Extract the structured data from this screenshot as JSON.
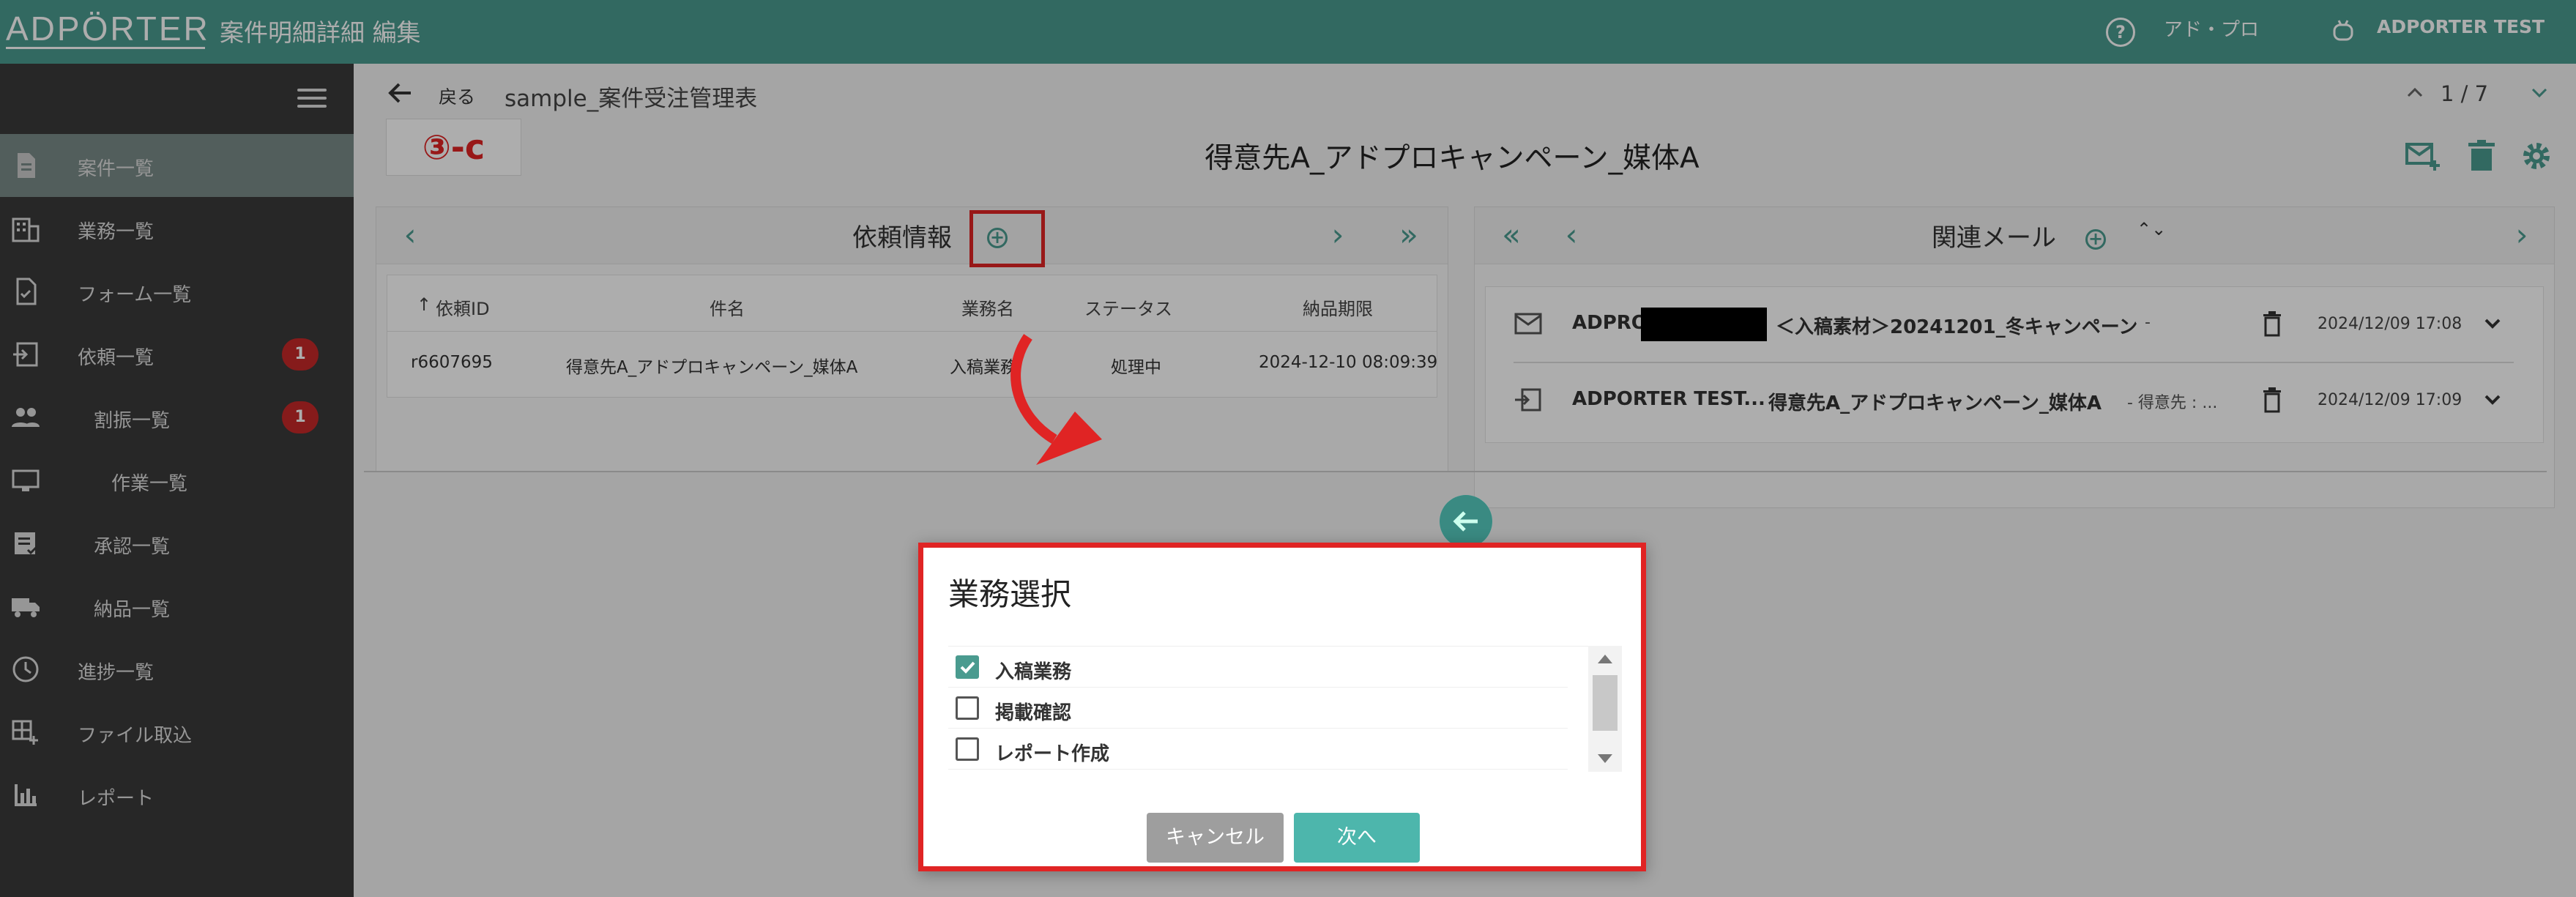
{
  "header": {
    "logo": "ADPÖRTER",
    "app_title": "案件明細詳細 編集",
    "help_glyph": "?",
    "user_org": "アド・プロ",
    "user_name": "ADPORTER TEST"
  },
  "sidebar": {
    "items": [
      {
        "label": "案件一覧",
        "icon": "document-icon",
        "active": true
      },
      {
        "label": "業務一覧",
        "icon": "building-icon"
      },
      {
        "label": "フォーム一覧",
        "icon": "form-icon"
      },
      {
        "label": "依頼一覧",
        "icon": "login-icon",
        "badge": "1"
      },
      {
        "label": "割振一覧",
        "icon": "people-icon",
        "badge": "1"
      },
      {
        "label": "作業一覧",
        "icon": "monitor-icon"
      },
      {
        "label": "承認一覧",
        "icon": "approve-icon"
      },
      {
        "label": "納品一覧",
        "icon": "truck-icon"
      },
      {
        "label": "進捗一覧",
        "icon": "clock-icon"
      },
      {
        "label": "ファイル取込",
        "icon": "table-add-icon"
      },
      {
        "label": "レポート",
        "icon": "bar-chart-icon"
      }
    ]
  },
  "topbar": {
    "back_label": "戻る",
    "sheet_title": "sample_案件受注管理表",
    "pager": "1 / 7"
  },
  "step_label": "③-c",
  "case_title": "得意先A_アドプロキャンペーン_媒体A",
  "request_panel": {
    "title": "依頼情報",
    "columns": [
      "依頼ID",
      "件名",
      "業務名",
      "ステータス",
      "納品期限"
    ],
    "sort_indicator": "↑",
    "rows": [
      [
        "r6607695",
        "得意先A_アドプロキャンペーン_媒体A",
        "入稿業務",
        "処理中",
        "2024-12-10 08:09:39"
      ]
    ]
  },
  "mail_panel": {
    "title": "関連メール",
    "sort_glyph": "⌃⌄",
    "items": [
      {
        "from": "ADPRO",
        "subject": "＜入稿素材＞20241201_冬キャンペーン",
        "extra": "-",
        "date": "2024/12/09 17:08"
      },
      {
        "from": "ADPORTER TEST...",
        "subject": "得意先A_アドプロキャンペーン_媒体A",
        "extra": "- 得意先 : ...",
        "date": "2024/12/09 17:09"
      }
    ]
  },
  "dialog": {
    "title": "業務選択",
    "options": [
      {
        "label": "入稿業務",
        "checked": true
      },
      {
        "label": "掲載確認",
        "checked": false
      },
      {
        "label": "レポート作成",
        "checked": false
      }
    ],
    "cancel_label": "キャンセル",
    "next_label": "次へ"
  },
  "colors": {
    "brand": "#4a9b8f",
    "accent": "#4db6ac",
    "highlight": "#e02424",
    "sidebar_bg": "#3a3a3a"
  }
}
